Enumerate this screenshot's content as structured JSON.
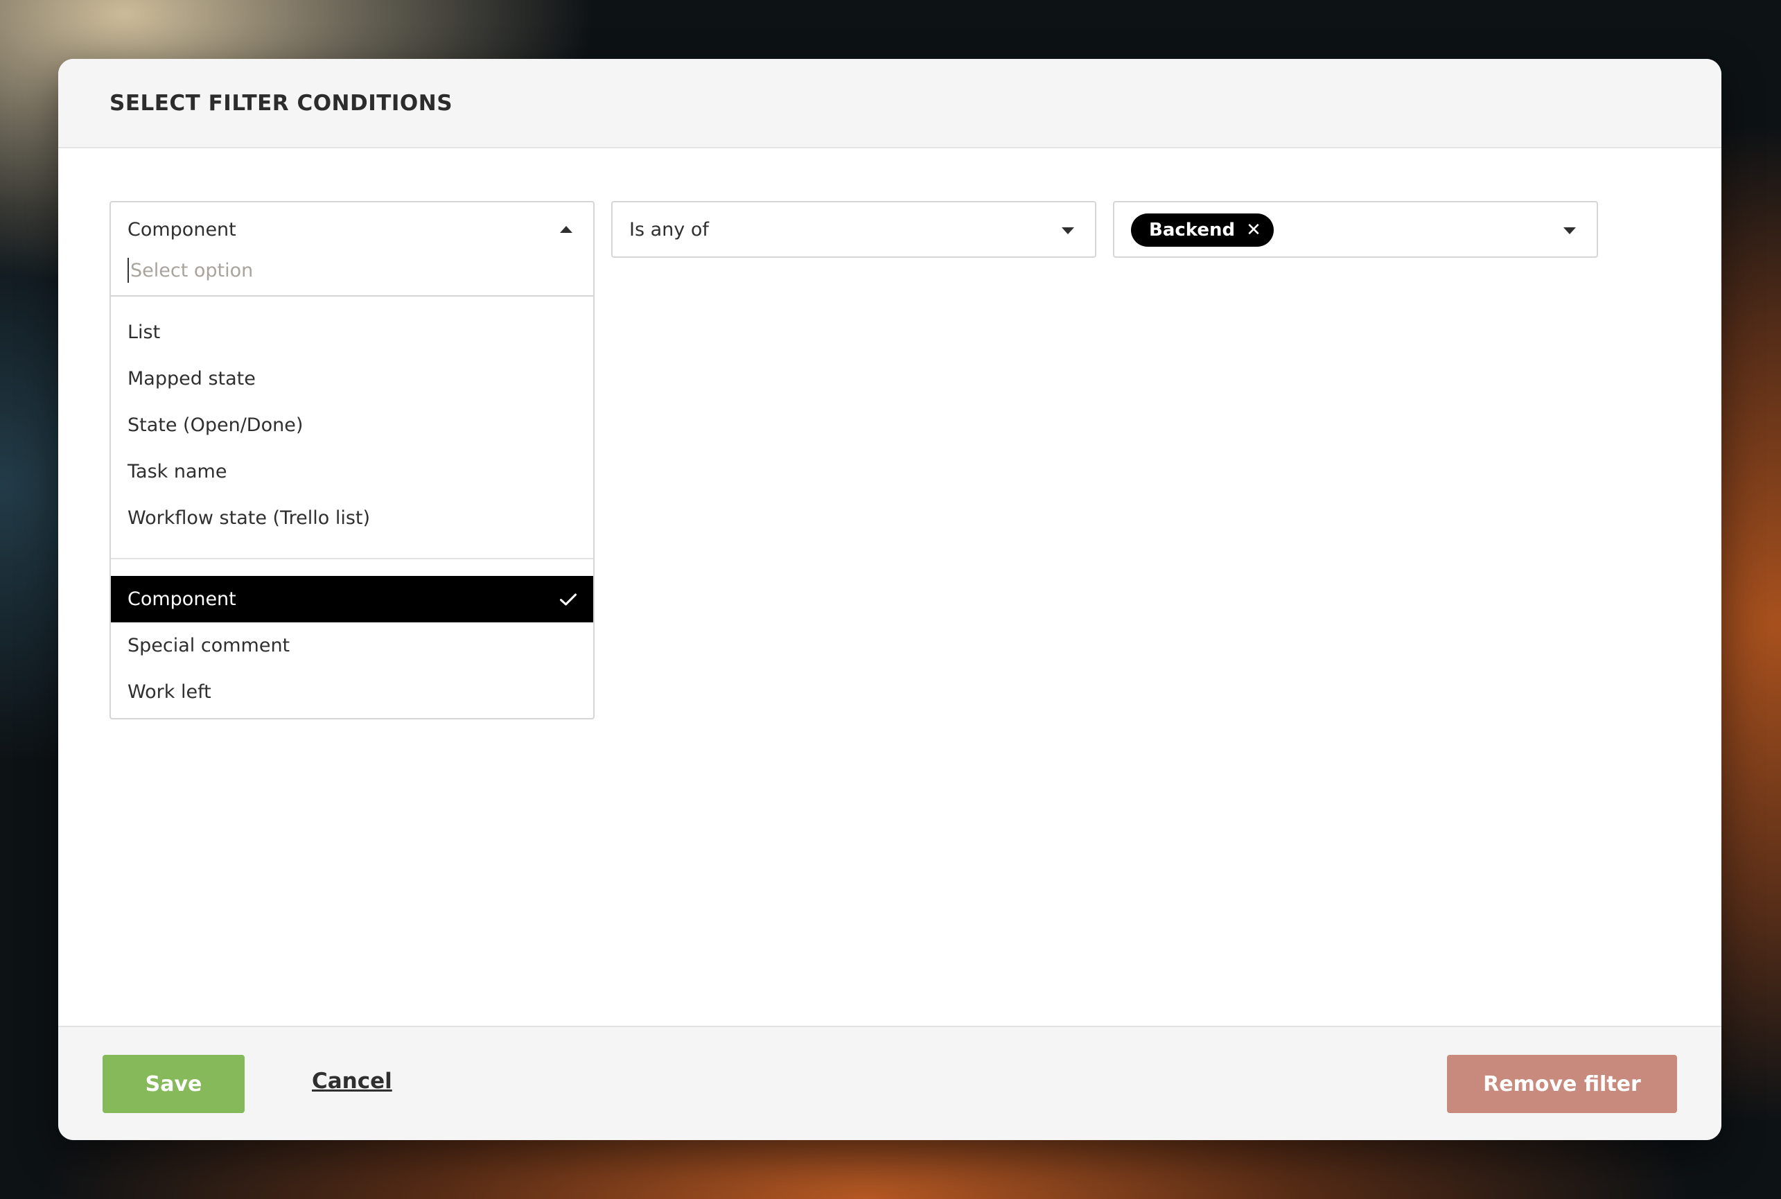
{
  "dialog": {
    "title": "SELECT FILTER CONDITIONS"
  },
  "field_select": {
    "value": "Component",
    "search_placeholder": "Select option",
    "options_group1": [
      "List",
      "Mapped state",
      "State (Open/Done)",
      "Task name",
      "Workflow state (Trello list)"
    ],
    "options_group2": [
      "Component",
      "Special comment",
      "Work left"
    ],
    "selected_option": "Component"
  },
  "operator_select": {
    "value": "Is any of"
  },
  "value_select": {
    "chips": [
      "Backend"
    ]
  },
  "footer": {
    "save_label": "Save",
    "cancel_label": "Cancel",
    "remove_label": "Remove filter"
  },
  "colors": {
    "save": "#86b95a",
    "remove": "#c98a7e",
    "selected_bg": "#000000"
  },
  "icons": {
    "caret_open": "caret-up-icon",
    "caret_closed": "caret-down-icon",
    "check": "check-icon",
    "chip_remove": "close-icon"
  }
}
